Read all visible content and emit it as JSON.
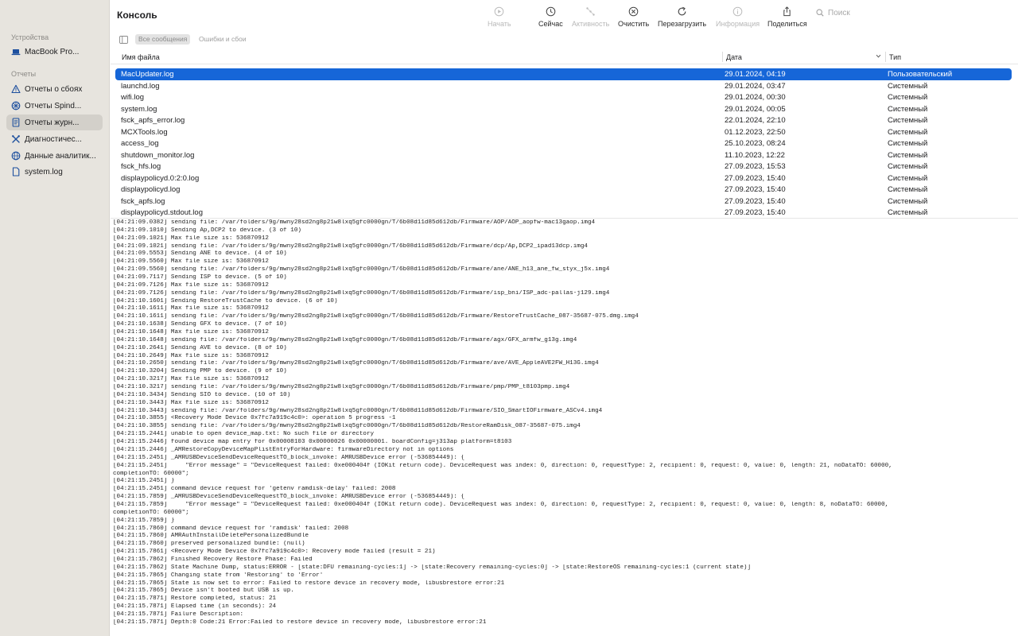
{
  "window": {
    "title": "Консоль"
  },
  "sidebar": {
    "devices_header": "Устройства",
    "device": "MacBook Pro...",
    "reports_header": "Отчеты",
    "items": [
      {
        "label": "Отчеты о сбоях",
        "icon": "warning-triangle-icon"
      },
      {
        "label": "Отчеты Spind...",
        "icon": "spindump-icon"
      },
      {
        "label": "Отчеты журн...",
        "icon": "log-report-icon",
        "selected": true
      },
      {
        "label": "Диагностичес...",
        "icon": "tools-icon"
      },
      {
        "label": "Данные аналитик...",
        "icon": "analytics-icon"
      },
      {
        "label": "system.log",
        "icon": "document-icon"
      }
    ]
  },
  "toolbar": {
    "buttons": [
      {
        "label": "Начать",
        "icon": "start-icon",
        "enabled": false
      },
      {
        "label": "Сейчас",
        "icon": "now-icon",
        "enabled": true
      },
      {
        "label": "Активность",
        "icon": "activity-icon",
        "enabled": false
      },
      {
        "label": "Очистить",
        "icon": "clear-icon",
        "enabled": true
      },
      {
        "label": "Перезагрузить",
        "icon": "reload-icon",
        "enabled": true
      },
      {
        "label": "Информация",
        "icon": "info-icon",
        "enabled": false
      },
      {
        "label": "Поделиться",
        "icon": "share-icon",
        "enabled": true
      }
    ],
    "search_placeholder": "Поиск"
  },
  "filter": {
    "all_messages": "Все сообщения",
    "errors_faults": "Ошибки и сбои"
  },
  "table": {
    "columns": {
      "name": "Имя файла",
      "date": "Дата",
      "type": "Тип"
    },
    "rows": [
      {
        "name": "MacUpdater.log",
        "date": "29.01.2024, 04:19",
        "type": "Пользовательский",
        "selected": true
      },
      {
        "name": "launchd.log",
        "date": "29.01.2024, 03:47",
        "type": "Системный"
      },
      {
        "name": "wifi.log",
        "date": "29.01.2024, 00:30",
        "type": "Системный"
      },
      {
        "name": "system.log",
        "date": "29.01.2024, 00:05",
        "type": "Системный"
      },
      {
        "name": "fsck_apfs_error.log",
        "date": "22.01.2024, 22:10",
        "type": "Системный"
      },
      {
        "name": "MCXTools.log",
        "date": "01.12.2023, 22:50",
        "type": "Системный"
      },
      {
        "name": "access_log",
        "date": "25.10.2023, 08:24",
        "type": "Системный"
      },
      {
        "name": "shutdown_monitor.log",
        "date": "11.10.2023, 12:22",
        "type": "Системный"
      },
      {
        "name": "fsck_hfs.log",
        "date": "27.09.2023, 15:53",
        "type": "Системный"
      },
      {
        "name": "displaypolicyd.0:2:0.log",
        "date": "27.09.2023, 15:40",
        "type": "Системный"
      },
      {
        "name": "displaypolicyd.log",
        "date": "27.09.2023, 15:40",
        "type": "Системный"
      },
      {
        "name": "fsck_apfs.log",
        "date": "27.09.2023, 15:40",
        "type": "Системный"
      },
      {
        "name": "displaypolicyd.stdout.log",
        "date": "27.09.2023, 15:40",
        "type": "Системный"
      }
    ]
  },
  "log_lines": [
    "[04:21:09.0382] sending file: /var/folders/9g/mwny28sd2ng8p21w8lxq5gfc0000gn/T/6b08d11d85d612db/Firmware/AOP/AOP_aopfw-mac13gaop.img4",
    "[04:21:09.1010] Sending Ap,DCP2 to device. (3 of 10)",
    "[04:21:09.1021] Max file size is: 536870912",
    "[04:21:09.1021] sending file: /var/folders/9g/mwny28sd2ng8p21w8lxq5gfc0000gn/T/6b08d11d85d612db/Firmware/dcp/Ap,DCP2_ipad13dcp.img4",
    "[04:21:09.5553] Sending ANE to device. (4 of 10)",
    "[04:21:09.5560] Max file size is: 536870912",
    "[04:21:09.5560] sending file: /var/folders/9g/mwny28sd2ng8p21w8lxq5gfc0000gn/T/6b08d11d85d612db/Firmware/ane/ANE_h13_ane_fw_styx_j5x.img4",
    "[04:21:09.7117] Sending ISP to device. (5 of 10)",
    "[04:21:09.7126] Max file size is: 536870912",
    "[04:21:09.7126] sending file: /var/folders/9g/mwny28sd2ng8p21w8lxq5gfc0000gn/T/6b08d11d85d612db/Firmware/isp_bni/ISP_adc-pallas-j129.img4",
    "[04:21:10.1601] Sending RestoreTrustCache to device. (6 of 10)",
    "[04:21:10.1611] Max file size is: 536870912",
    "[04:21:10.1611] sending file: /var/folders/9g/mwny28sd2ng8p21w8lxq5gfc0000gn/T/6b08d11d85d612db/Firmware/RestoreTrustCache_087-35687-075.dmg.img4",
    "[04:21:10.1638] Sending GFX to device. (7 of 10)",
    "[04:21:10.1648] Max file size is: 536870912",
    "[04:21:10.1648] sending file: /var/folders/9g/mwny28sd2ng8p21w8lxq5gfc0000gn/T/6b08d11d85d612db/Firmware/agx/GFX_armfw_g13g.img4",
    "[04:21:10.2641] Sending AVE to device. (8 of 10)",
    "[04:21:10.2649] Max file size is: 536870912",
    "[04:21:10.2650] sending file: /var/folders/9g/mwny28sd2ng8p21w8lxq5gfc0000gn/T/6b08d11d85d612db/Firmware/ave/AVE_AppleAVE2FW_H13G.img4",
    "[04:21:10.3204] Sending PMP to device. (9 of 10)",
    "[04:21:10.3217] Max file size is: 536870912",
    "[04:21:10.3217] sending file: /var/folders/9g/mwny28sd2ng8p21w8lxq5gfc0000gn/T/6b08d11d85d612db/Firmware/pmp/PMP_t8103pmp.img4",
    "[04:21:10.3434] Sending SIO to device. (10 of 10)",
    "[04:21:10.3443] Max file size is: 536870912",
    "[04:21:10.3443] sending file: /var/folders/9g/mwny28sd2ng8p21w8lxq5gfc0000gn/T/6b08d11d85d612db/Firmware/SIO_SmartIOFirmware_ASCv4.img4",
    "[04:21:10.3855] <Recovery Mode Device 0x7fc7a919c4c0>: operation 5 progress -1",
    "[04:21:10.3855] sending file: /var/folders/9g/mwny28sd2ng8p21w8lxq5gfc0000gn/T/6b08d11d85d612db/RestoreRamDisk_087-35687-075.img4",
    "[04:21:15.2441] unable to open device_map.txt: No such file or directory",
    "[04:21:15.2446] found device map entry for 0x00008103 0x00000026 0x00000001. boardConfig=j313ap platform=t8103",
    "[04:21:15.2446] _AMRestoreCopyDeviceMapPlistEntryForHardware: firmwareDirectory not in options",
    "[04:21:15.2451] _AMRUSBDeviceSendDeviceRequestTO_block_invoke: AMRUSBDevice error (-536854449): {",
    "[04:21:15.2451]     \"Error message\" = \"DeviceRequest failed: 0xe000404f (IOKit return code). DeviceRequest was index: 0, direction: 0, requestType: 2, recipient: 0, request: 0, value: 0, length: 21, noDataTO: 60000,",
    "completionTO: 60000\";",
    "[04:21:15.2451] }",
    "[04:21:15.2451] command device request for 'getenv ramdisk-delay' failed: 2008",
    "[04:21:15.7859] _AMRUSBDeviceSendDeviceRequestTO_block_invoke: AMRUSBDevice error (-536854449): {",
    "[04:21:15.7859]     \"Error message\" = \"DeviceRequest failed: 0xe000404f (IOKit return code). DeviceRequest was index: 0, direction: 0, requestType: 2, recipient: 0, request: 0, value: 0, length: 8, noDataTO: 60000,",
    "completionTO: 60000\";",
    "[04:21:15.7859] }",
    "[04:21:15.7860] command device request for 'ramdisk' failed: 2008",
    "[04:21:15.7860] AMRAuthInstallDeletePersonalizedBundle",
    "[04:21:15.7860] preserved personalized bundle: (null)",
    "[04:21:15.7861] <Recovery Mode Device 0x7fc7a919c4c0>: Recovery mode failed (result = 21)",
    "[04:21:15.7862] Finished Recovery Restore Phase: Failed",
    "[04:21:15.7862] State Machine Dump, status:ERROR - [state:DFU remaining-cycles:1] -> [state:Recovery remaining-cycles:0] -> [state:RestoreOS remaining-cycles:1 (current state)]",
    "[04:21:15.7865] Changing state from 'Restoring' to 'Error'",
    "[04:21:15.7865] State is now set to error: Failed to restore device in recovery mode, libusbrestore error:21",
    "[04:21:15.7865] Device isn't booted but USB is up.",
    "[04:21:15.7871] Restore completed, status: 21",
    "[04:21:15.7871] Elapsed time (in seconds): 24",
    "[04:21:15.7871] Failure Description:",
    "[04:21:15.7871] Depth:0 Code:21 Error:Failed to restore device in recovery mode, libusbrestore error:21"
  ]
}
